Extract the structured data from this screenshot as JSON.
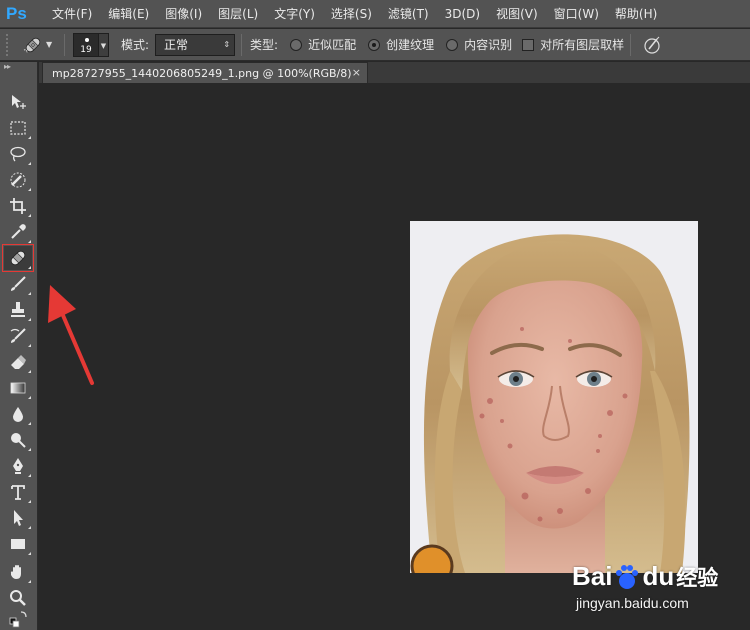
{
  "app": {
    "logo": "Ps",
    "accent": "#31a8ff",
    "menu": [
      "文件(F)",
      "编辑(E)",
      "图像(I)",
      "图层(L)",
      "文字(Y)",
      "选择(S)",
      "滤镜(T)",
      "3D(D)",
      "视图(V)",
      "窗口(W)",
      "帮助(H)"
    ]
  },
  "options": {
    "tool_icon": "spot-healing-brush-icon",
    "brush_size": "19",
    "mode_label": "模式:",
    "mode_value": "正常",
    "type_label": "类型:",
    "radio_1": "近似匹配",
    "radio_2": "创建纹理",
    "radio_3": "内容识别",
    "selected_type": "创建纹理",
    "sample_all_layers": "对所有图层取样",
    "sample_all_layers_checked": false,
    "pressure_icon": "pressure-size-icon"
  },
  "toolbar": {
    "collapse_glyph": "▸▸",
    "tools": [
      "move-tool-icon",
      "rect-marquee-icon",
      "lasso-icon",
      "quick-selection-icon",
      "crop-icon",
      "eyedropper-icon",
      "spot-healing-brush-icon",
      "brush-icon",
      "clone-stamp-icon",
      "history-brush-icon",
      "eraser-icon",
      "gradient-icon",
      "blur-icon",
      "dodge-icon",
      "pen-icon",
      "type-icon",
      "path-selection-icon",
      "rectangle-shape-icon",
      "hand-icon",
      "zoom-icon",
      "swap-colors-icon"
    ],
    "active_tool": "spot-healing-brush-icon",
    "highlight_color": "#e53935"
  },
  "document": {
    "tab_title": "mp28727955_1440206805249_1.png @ 100%(RGB/8)",
    "close_glyph": "×"
  },
  "annotation": {
    "arrow_color": "#e53935"
  },
  "watermark": {
    "brand_left": "Bai",
    "brand_right": "du",
    "brand_cn": "经验",
    "url": "jingyan.baidu.com"
  }
}
